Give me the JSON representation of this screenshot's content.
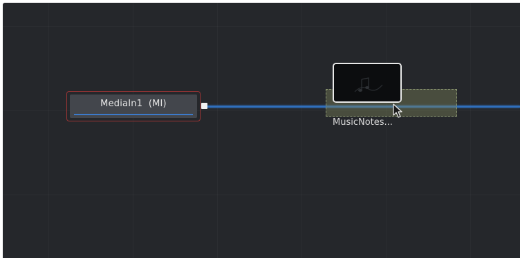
{
  "nodes": {
    "mediain": {
      "label": "MediaIn1  (MI)"
    },
    "music_notes": {
      "caption": "MusicNotes..."
    }
  },
  "icons": {
    "cursor": "mouse-pointer-icon",
    "port": "output-port-icon"
  },
  "colors": {
    "background": "#25272b",
    "connection": "#2f6fbd",
    "selected_border": "#9a3434",
    "marquee_fill": "#7c8458"
  }
}
